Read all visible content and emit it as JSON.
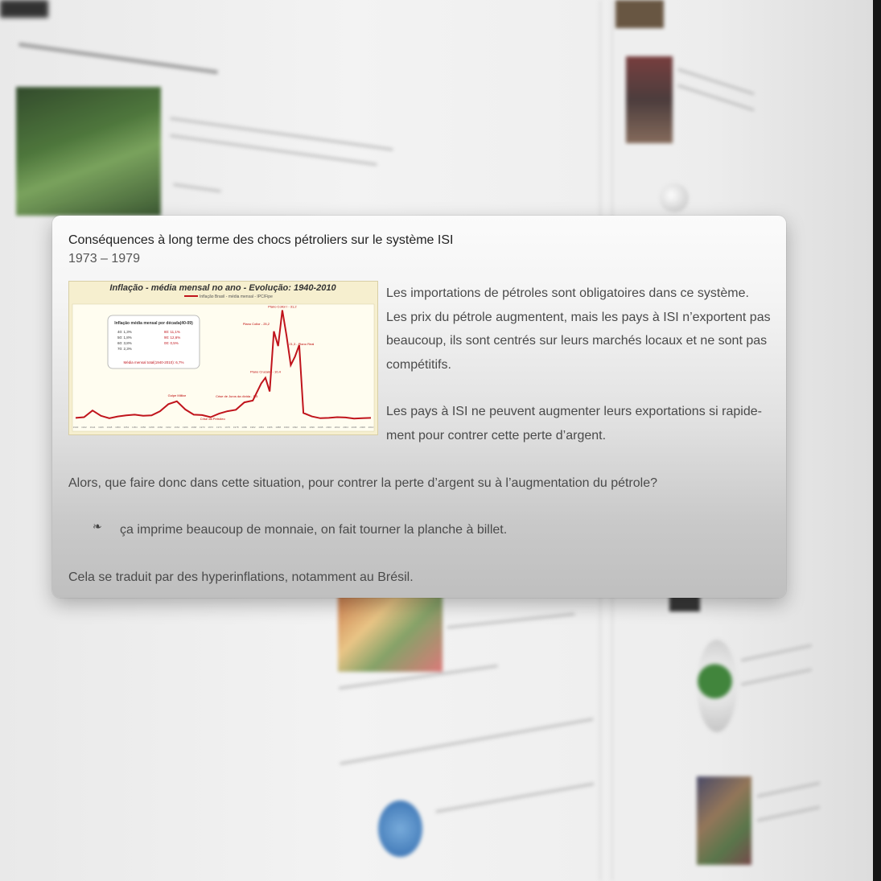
{
  "card": {
    "title": "Conséquences à long terme des chocs pétroliers sur le système ISI",
    "years": "1973 – 1979",
    "para1": "Les importations de pétroles sont obligatoires dans ce système. Les prix du pétrole augmentent, mais les pays à ISI n’exportent pas beaucoup, ils sont centrés sur leurs marchés locaux et ne sont pas compétitifs.",
    "para2": "Les pays à ISI ne peuvent augmenter leurs exportations si rapide-ment pour contrer cette perte d’argent.",
    "para3": "Alors, que faire donc dans cette situation, pour contrer la perte d’argent su à l’augmentation du pétrole?",
    "bullet": "ça imprime beaucoup de monnaie, on fait tourner la planche à billet.",
    "para4": "Cela se traduit par des hyperinflations, notamment au Brésil.",
    "bullet_icon": "floral-heart-bullet-icon"
  },
  "chart_data": {
    "type": "line",
    "title": "Inflação - média mensal no ano - Evolução: 1940-2010",
    "series": [
      {
        "name": "Inflação Brasil - média mensal - IPC/Fipe",
        "x": [
          1940,
          1942,
          1944,
          1946,
          1948,
          1950,
          1952,
          1954,
          1956,
          1958,
          1960,
          1962,
          1964,
          1966,
          1968,
          1970,
          1972,
          1974,
          1976,
          1978,
          1980,
          1982,
          1984,
          1985,
          1986,
          1987,
          1988,
          1989,
          1990,
          1991,
          1992,
          1993,
          1994,
          1995,
          1996,
          1998,
          2000,
          2002,
          2004,
          2006,
          2008,
          2010
        ],
        "values": [
          0.6,
          0.8,
          2.7,
          1.2,
          0.5,
          1.0,
          1.3,
          1.5,
          1.2,
          1.3,
          2.5,
          4.5,
          5.3,
          3.0,
          1.5,
          1.4,
          0.8,
          1.8,
          2.5,
          2.9,
          5.0,
          5.5,
          10.4,
          12.0,
          8.1,
          25.2,
          21.0,
          31.2,
          24.0,
          15.6,
          18.0,
          21.3,
          2.0,
          1.5,
          1.0,
          0.5,
          0.6,
          0.8,
          0.7,
          0.4,
          0.5,
          0.6
        ]
      }
    ],
    "color": "#c0141c",
    "ylim": [
      0,
      32
    ],
    "annotations": [
      "Plano Collor I - 31,2",
      "Plano Cruzado - 10,4",
      "Plano Collor - 25,2",
      "21,3 - Plano Real",
      "Golpe Militar",
      "Crise da Petróleo",
      "Crise de Juros da dívida - 5,5"
    ],
    "inset_title": "Inflação média mensal por década(40-09)",
    "inset_rows": [
      "40: 1,3%",
      "50: 1,8%",
      "60: 3,8%",
      "70: 2,3%",
      "80: 11,1%",
      "90: 12,6%",
      "00: 0,5%"
    ],
    "inset_total": "Média mensal total(1940-2010): 6,7%"
  }
}
